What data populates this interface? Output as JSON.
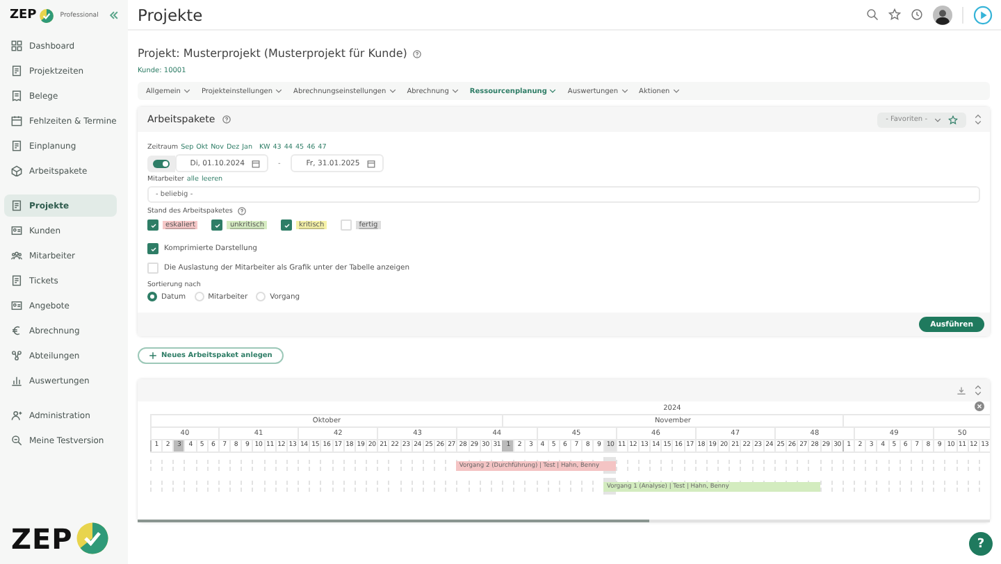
{
  "sidebar": {
    "brand": "ZEP",
    "edition": "Professional",
    "groups": [
      [
        {
          "label": "Dashboard",
          "selected": false
        },
        {
          "label": "Projektzeiten",
          "selected": false
        },
        {
          "label": "Belege",
          "selected": false
        },
        {
          "label": "Fehlzeiten & Termine",
          "selected": false
        },
        {
          "label": "Einplanung",
          "selected": false
        },
        {
          "label": "Arbeitspakete",
          "selected": false
        }
      ],
      [
        {
          "label": "Projekte",
          "selected": true
        },
        {
          "label": "Kunden",
          "selected": false
        },
        {
          "label": "Mitarbeiter",
          "selected": false
        },
        {
          "label": "Tickets",
          "selected": false
        },
        {
          "label": "Angebote",
          "selected": false
        },
        {
          "label": "Abrechnung",
          "selected": false
        },
        {
          "label": "Abteilungen",
          "selected": false
        },
        {
          "label": "Auswertungen",
          "selected": false
        }
      ],
      [
        {
          "label": "Administration",
          "selected": false
        },
        {
          "label": "Meine Testversion",
          "selected": false
        }
      ]
    ],
    "footer_brand": "ZEP"
  },
  "header": {
    "title": "Projekte"
  },
  "project": {
    "title": "Projekt: Musterprojekt (Musterprojekt für Kunde)",
    "customer": "Kunde: 10001"
  },
  "tabs": [
    {
      "label": "Allgemein",
      "selected": false
    },
    {
      "label": "Projekteinstellungen",
      "selected": false
    },
    {
      "label": "Abrechnungseinstellungen",
      "selected": false
    },
    {
      "label": "Abrechnung",
      "selected": false
    },
    {
      "label": "Ressourcenplanung",
      "selected": true
    },
    {
      "label": "Auswertungen",
      "selected": false
    },
    {
      "label": "Aktionen",
      "selected": false
    }
  ],
  "filter_panel": {
    "title": "Arbeitspakete",
    "favorites": "- Favoriten -",
    "period": {
      "label": "Zeitraum",
      "months": [
        "Sep",
        "Okt",
        "Nov",
        "Dez",
        "Jan"
      ],
      "weeks_label": "KW",
      "weeks": [
        "43",
        "44",
        "45",
        "46",
        "47"
      ],
      "toggle_on": true,
      "from": "Di, 01.10.2024",
      "separator": "-",
      "to": "Fr, 31.01.2025"
    },
    "employees": {
      "label": "Mitarbeiter",
      "links": [
        "alle",
        "leeren"
      ],
      "value": "- beliebig -"
    },
    "status": {
      "label": "Stand des Arbeitspaketes",
      "options": [
        {
          "label": "eskaliert",
          "checked": true,
          "color": "#f6c8c8"
        },
        {
          "label": "unkritisch",
          "checked": true,
          "color": "#d6ecc2"
        },
        {
          "label": "kritisch",
          "checked": true,
          "color": "#f6f2a8"
        },
        {
          "label": "fertig",
          "checked": false,
          "color": "#dddddd"
        }
      ]
    },
    "options": [
      {
        "label": "Komprimierte Darstellung",
        "checked": true
      },
      {
        "label": "Die Auslastung der Mitarbeiter als Grafik unter der Tabelle anzeigen",
        "checked": false
      }
    ],
    "sorting": {
      "label": "Sortierung nach",
      "options": [
        {
          "label": "Datum",
          "selected": true
        },
        {
          "label": "Mitarbeiter",
          "selected": false
        },
        {
          "label": "Vorgang",
          "selected": false
        }
      ]
    },
    "submit": "Ausführen"
  },
  "new_button": "Neues Arbeitspaket anlegen",
  "gantt": {
    "year": "2024",
    "months": [
      "Oktober",
      "November"
    ],
    "weeks": [
      {
        "label": "40",
        "days": [
          {
            "label": "1",
            "new_month": true,
            "marked": false,
            "shaded": false
          },
          {
            "label": "2",
            "new_month": false,
            "marked": false,
            "shaded": false
          },
          {
            "label": "3",
            "new_month": false,
            "marked": true,
            "shaded": false
          },
          {
            "label": "4",
            "new_month": false,
            "marked": false,
            "shaded": false
          },
          {
            "label": "5",
            "new_month": false,
            "marked": false,
            "shaded": false
          },
          {
            "label": "6",
            "new_month": false,
            "marked": false,
            "shaded": false
          }
        ]
      },
      {
        "label": "41",
        "days": [
          {
            "label": "7",
            "new_month": false,
            "marked": false,
            "shaded": false
          },
          {
            "label": "8",
            "new_month": false,
            "marked": false,
            "shaded": false
          },
          {
            "label": "9",
            "new_month": false,
            "marked": false,
            "shaded": false
          },
          {
            "label": "10",
            "new_month": false,
            "marked": false,
            "shaded": false
          },
          {
            "label": "11",
            "new_month": false,
            "marked": false,
            "shaded": false
          },
          {
            "label": "12",
            "new_month": false,
            "marked": false,
            "shaded": false
          },
          {
            "label": "13",
            "new_month": false,
            "marked": false,
            "shaded": false
          }
        ]
      },
      {
        "label": "42",
        "days": [
          {
            "label": "14",
            "new_month": false,
            "marked": false,
            "shaded": false
          },
          {
            "label": "15",
            "new_month": false,
            "marked": false,
            "shaded": false
          },
          {
            "label": "16",
            "new_month": false,
            "marked": false,
            "shaded": false
          },
          {
            "label": "17",
            "new_month": false,
            "marked": false,
            "shaded": false
          },
          {
            "label": "18",
            "new_month": false,
            "marked": false,
            "shaded": false
          },
          {
            "label": "19",
            "new_month": false,
            "marked": false,
            "shaded": false
          },
          {
            "label": "20",
            "new_month": false,
            "marked": false,
            "shaded": false
          }
        ]
      },
      {
        "label": "43",
        "days": [
          {
            "label": "21",
            "new_month": false,
            "marked": false,
            "shaded": false
          },
          {
            "label": "22",
            "new_month": false,
            "marked": false,
            "shaded": false
          },
          {
            "label": "23",
            "new_month": false,
            "marked": false,
            "shaded": false
          },
          {
            "label": "24",
            "new_month": false,
            "marked": false,
            "shaded": false
          },
          {
            "label": "25",
            "new_month": false,
            "marked": false,
            "shaded": false
          },
          {
            "label": "26",
            "new_month": false,
            "marked": false,
            "shaded": false
          },
          {
            "label": "27",
            "new_month": false,
            "marked": false,
            "shaded": false
          }
        ]
      },
      {
        "label": "44",
        "days": [
          {
            "label": "28",
            "new_month": false,
            "marked": false,
            "shaded": false
          },
          {
            "label": "29",
            "new_month": false,
            "marked": false,
            "shaded": false
          },
          {
            "label": "30",
            "new_month": false,
            "marked": false,
            "shaded": false
          },
          {
            "label": "31",
            "new_month": false,
            "marked": false,
            "shaded": false
          },
          {
            "label": "1",
            "new_month": true,
            "marked": true,
            "shaded": false
          },
          {
            "label": "2",
            "new_month": false,
            "marked": false,
            "shaded": false
          },
          {
            "label": "3",
            "new_month": false,
            "marked": false,
            "shaded": false
          }
        ]
      },
      {
        "label": "45",
        "days": [
          {
            "label": "4",
            "new_month": false,
            "marked": false,
            "shaded": false
          },
          {
            "label": "5",
            "new_month": false,
            "marked": false,
            "shaded": false
          },
          {
            "label": "6",
            "new_month": false,
            "marked": false,
            "shaded": false
          },
          {
            "label": "7",
            "new_month": false,
            "marked": false,
            "shaded": false
          },
          {
            "label": "8",
            "new_month": false,
            "marked": false,
            "shaded": false
          },
          {
            "label": "9",
            "new_month": false,
            "marked": false,
            "shaded": false
          },
          {
            "label": "10",
            "new_month": false,
            "marked": false,
            "shaded": true
          }
        ]
      },
      {
        "label": "46",
        "days": [
          {
            "label": "11",
            "new_month": false,
            "marked": false,
            "shaded": false
          },
          {
            "label": "12",
            "new_month": false,
            "marked": false,
            "shaded": false
          },
          {
            "label": "13",
            "new_month": false,
            "marked": false,
            "shaded": false
          },
          {
            "label": "14",
            "new_month": false,
            "marked": false,
            "shaded": false
          },
          {
            "label": "15",
            "new_month": false,
            "marked": false,
            "shaded": false
          },
          {
            "label": "16",
            "new_month": false,
            "marked": false,
            "shaded": false
          },
          {
            "label": "17",
            "new_month": false,
            "marked": false,
            "shaded": false
          }
        ]
      },
      {
        "label": "47",
        "days": [
          {
            "label": "18",
            "new_month": false,
            "marked": false,
            "shaded": false
          },
          {
            "label": "19",
            "new_month": false,
            "marked": false,
            "shaded": false
          },
          {
            "label": "20",
            "new_month": false,
            "marked": false,
            "shaded": false
          },
          {
            "label": "21",
            "new_month": false,
            "marked": false,
            "shaded": false
          },
          {
            "label": "22",
            "new_month": false,
            "marked": false,
            "shaded": false
          },
          {
            "label": "23",
            "new_month": false,
            "marked": false,
            "shaded": false
          },
          {
            "label": "24",
            "new_month": false,
            "marked": false,
            "shaded": false
          }
        ]
      },
      {
        "label": "48",
        "days": [
          {
            "label": "25",
            "new_month": false,
            "marked": false,
            "shaded": false
          },
          {
            "label": "26",
            "new_month": false,
            "marked": false,
            "shaded": false
          },
          {
            "label": "27",
            "new_month": false,
            "marked": false,
            "shaded": false
          },
          {
            "label": "28",
            "new_month": false,
            "marked": false,
            "shaded": false
          },
          {
            "label": "29",
            "new_month": false,
            "marked": false,
            "shaded": false
          },
          {
            "label": "30",
            "new_month": false,
            "marked": false,
            "shaded": false
          },
          {
            "label": "1",
            "new_month": true,
            "marked": false,
            "shaded": false
          }
        ]
      },
      {
        "label": "49",
        "days": [
          {
            "label": "2",
            "new_month": false,
            "marked": false,
            "shaded": false
          },
          {
            "label": "3",
            "new_month": false,
            "marked": false,
            "shaded": false
          },
          {
            "label": "4",
            "new_month": false,
            "marked": false,
            "shaded": false
          },
          {
            "label": "5",
            "new_month": false,
            "marked": false,
            "shaded": false
          },
          {
            "label": "6",
            "new_month": false,
            "marked": false,
            "shaded": false
          },
          {
            "label": "7",
            "new_month": false,
            "marked": false,
            "shaded": false
          },
          {
            "label": "8",
            "new_month": false,
            "marked": false,
            "shaded": false
          }
        ]
      },
      {
        "label": "50",
        "days": [
          {
            "label": "9",
            "new_month": false,
            "marked": false,
            "shaded": false
          },
          {
            "label": "10",
            "new_month": false,
            "marked": false,
            "shaded": false
          },
          {
            "label": "11",
            "new_month": false,
            "marked": false,
            "shaded": false
          },
          {
            "label": "12",
            "new_month": false,
            "marked": false,
            "shaded": false
          },
          {
            "label": "13",
            "new_month": false,
            "marked": false,
            "shaded": false
          }
        ]
      }
    ],
    "rows": [
      {
        "bar": {
          "text": "Vorgang 2 (Durchführung) | Test | Hahn, Benny",
          "color": "#f4c4c4"
        }
      },
      {
        "bar": {
          "text": "Vorgang 1 (Analyse) | Test | Hahn, Benny",
          "color": "#d3ecbf"
        }
      }
    ]
  },
  "help": "?"
}
